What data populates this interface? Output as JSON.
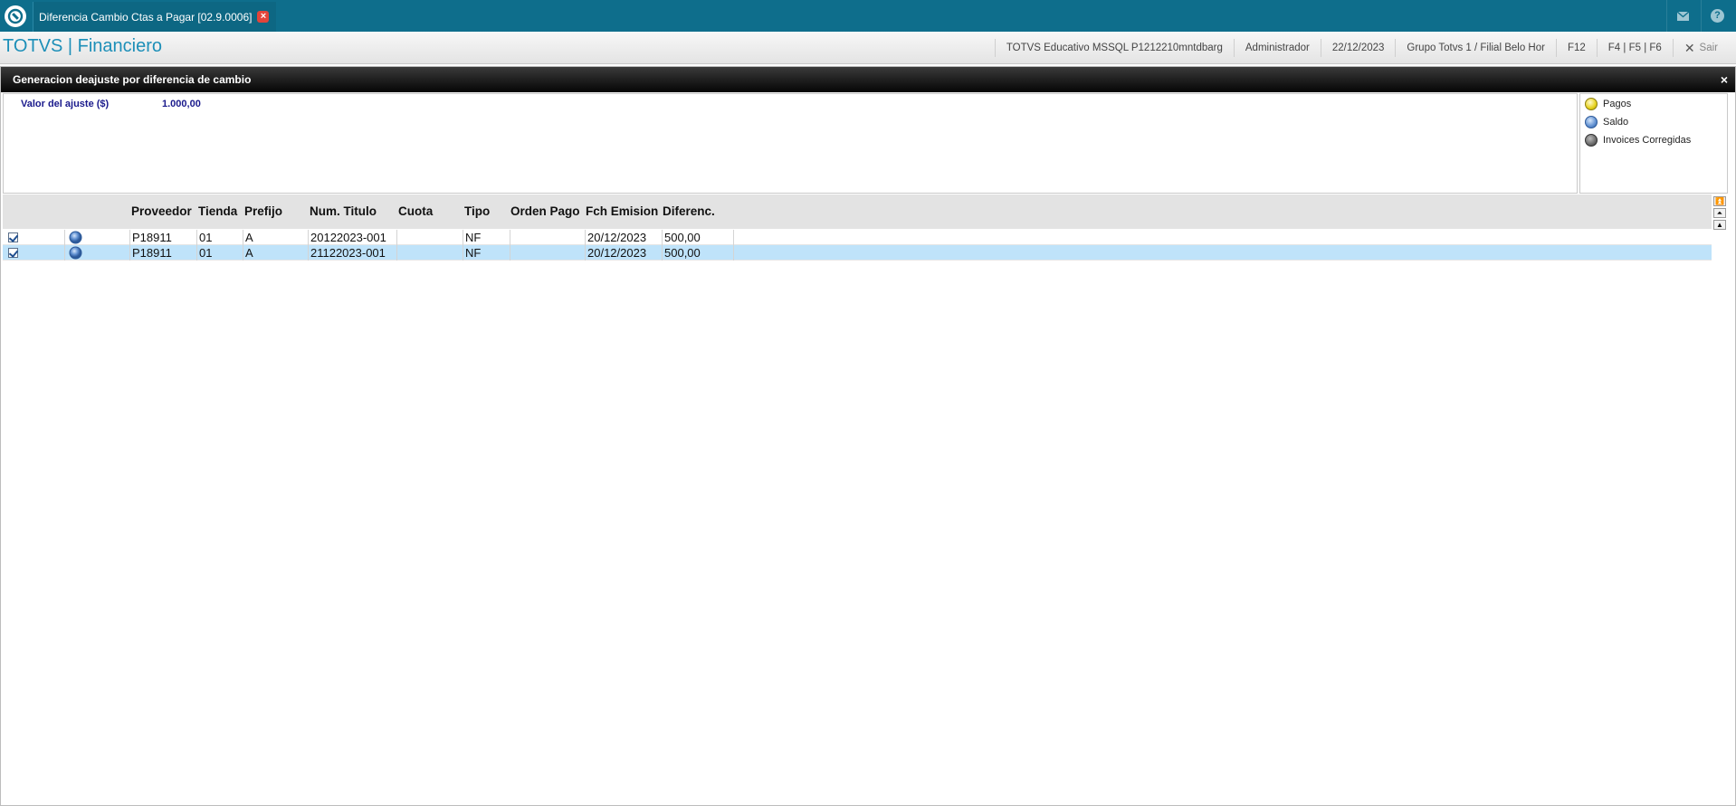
{
  "topbar": {
    "logo_icon": "totvs-logo-icon",
    "tab_title": "Diferencia Cambio Ctas a Pagar [02.9.0006]",
    "tab_close_icon": "close-icon",
    "mail_icon": "mail-icon",
    "help_icon": "help-icon",
    "help_glyph": "?"
  },
  "header": {
    "brand": "TOTVS | Financiero",
    "environment": "TOTVS Educativo MSSQL P1212210mntdbarg",
    "user": "Administrador",
    "date": "22/12/2023",
    "company": "Grupo Totvs 1 / Filial Belo Hor",
    "shortcut_f12": "F12",
    "shortcuts": "F4 | F5 | F6",
    "exit_label": "Sair"
  },
  "dialog": {
    "title": "Generacion deajuste por diferencia de cambio",
    "close_glyph": "×",
    "param_label": "Valor del ajuste ($)",
    "param_value": "1.000,00",
    "legend": [
      {
        "label": "Pagos",
        "color": "yellow"
      },
      {
        "label": "Saldo",
        "color": "blue"
      },
      {
        "label": "Invoices Corregidas",
        "color": "gray"
      }
    ]
  },
  "grid": {
    "columns": [
      "Proveedor",
      "Tienda",
      "Prefijo",
      "Num. Titulo",
      "Cuota",
      "Tipo",
      "Orden Pago",
      "Fch Emision",
      "Diferenc."
    ],
    "rows": [
      {
        "checked": true,
        "status": "blue",
        "proveedor": "P18911",
        "tienda": "01",
        "prefijo": "A",
        "num_titulo": "20122023-001",
        "cuota": "",
        "tipo": "NF",
        "orden_pago": "",
        "fch_emision": "20/12/2023",
        "diferenc": "500,00",
        "selected": false
      },
      {
        "checked": true,
        "status": "blue",
        "proveedor": "P18911",
        "tienda": "01",
        "prefijo": "A",
        "num_titulo": "21122023-001",
        "cuota": "",
        "tipo": "NF",
        "orden_pago": "",
        "fch_emision": "20/12/2023",
        "diferenc": "500,00",
        "selected": true
      }
    ],
    "scroll_buttons": [
      "⏫",
      "⏶⏶",
      "▲"
    ]
  },
  "colors": {
    "topbar": "#0e6e8c",
    "brand": "#1d8fb8",
    "selected_row": "#bfe3fa",
    "param_text": "#1a1a8c"
  }
}
